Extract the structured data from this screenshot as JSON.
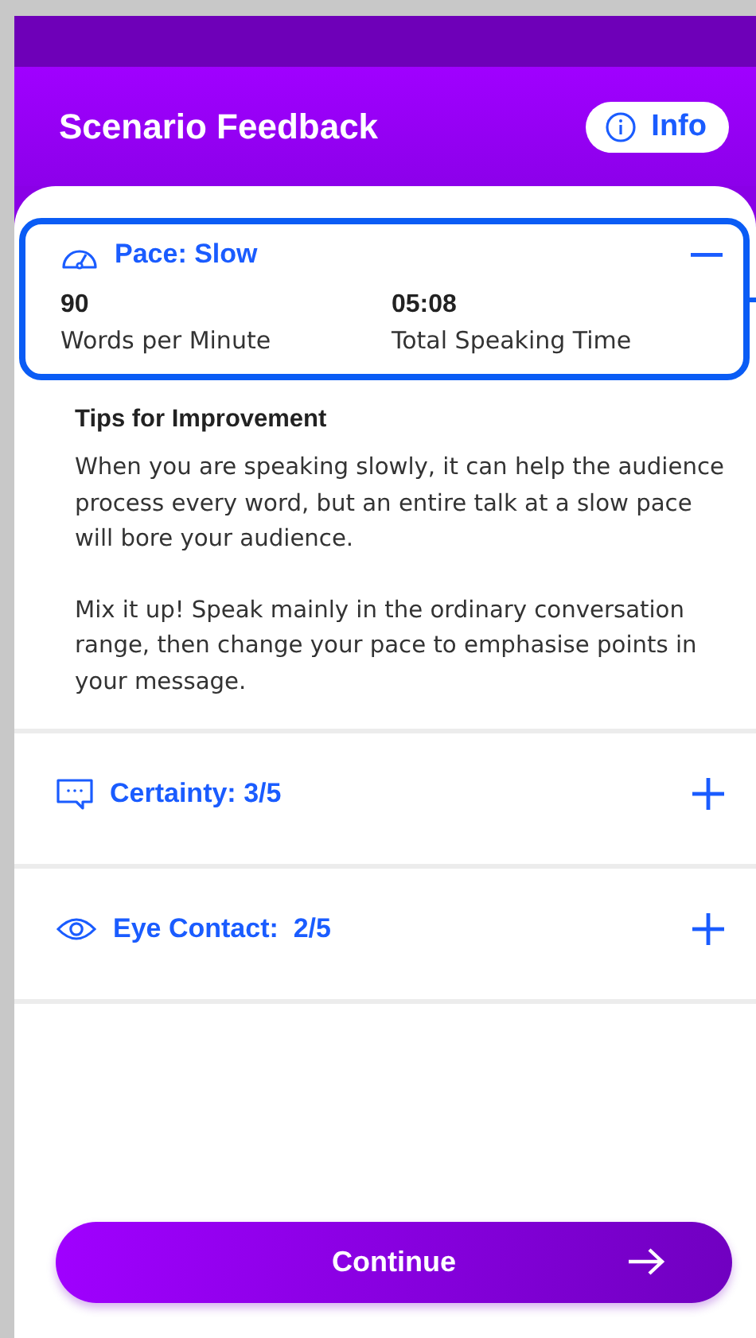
{
  "header": {
    "title": "Scenario Feedback",
    "info_button": "Info"
  },
  "sections": [
    {
      "title": "Pace: Slow",
      "expanded": true,
      "highlighted": true,
      "stats": [
        {
          "value": "90",
          "label": "Words per Minute"
        },
        {
          "value": "05:08",
          "label": "Total Speaking Time"
        }
      ],
      "tips_heading": "Tips for Improvement",
      "tips": [
        "When you are speaking slowly, it can help the audience process every word, but an entire talk at a slow pace will bore your audience.",
        "Mix it up! Speak mainly in the ordinary conversation range, then change your pace to emphasise points in your message."
      ]
    },
    {
      "title": "Certainty: 3/5",
      "expanded": false,
      "highlighted": false
    },
    {
      "title": "Eye Contact:  2/5",
      "expanded": false,
      "highlighted": false
    }
  ],
  "continue_button": "Continue"
}
